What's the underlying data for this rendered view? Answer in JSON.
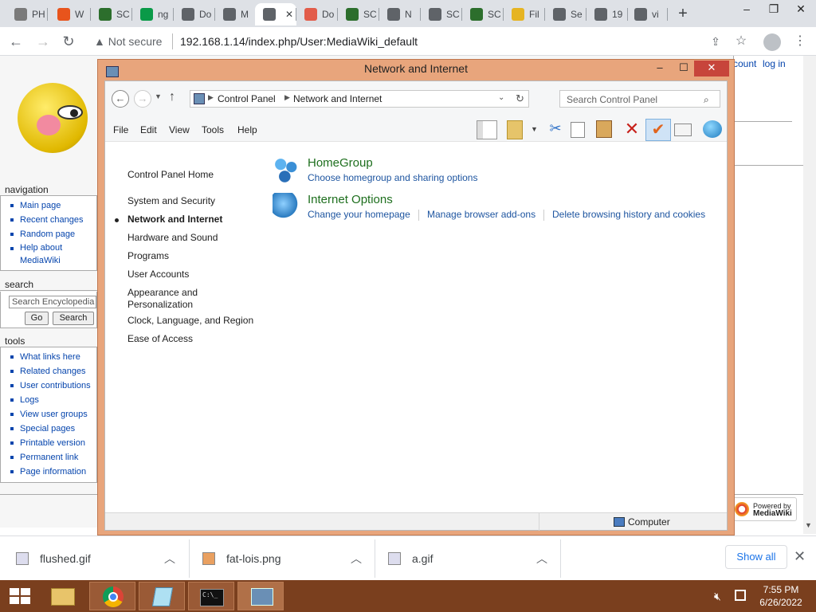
{
  "browser": {
    "tabs": [
      {
        "label": "PH",
        "icon": "globe-icon",
        "color": "#7a7a7a"
      },
      {
        "label": "W",
        "icon": "w-icon",
        "color": "#e8541c"
      },
      {
        "label": "SC",
        "icon": "sql-icon",
        "color": "#2c6e2c"
      },
      {
        "label": "ng",
        "icon": "nginx-icon",
        "color": "#0a9a48"
      },
      {
        "label": "Do",
        "icon": "download-icon",
        "color": "#5f6368"
      },
      {
        "label": "M",
        "icon": "globe-icon",
        "color": "#5f6368"
      },
      {
        "label": "",
        "icon": "globe-icon",
        "color": "#5f6368"
      },
      {
        "label": "Do",
        "icon": "doc-icon",
        "color": "#e25c4a"
      },
      {
        "label": "SC",
        "icon": "sql-icon",
        "color": "#2c6e2c"
      },
      {
        "label": "N",
        "icon": "globe-icon",
        "color": "#5f6368"
      },
      {
        "label": "SC",
        "icon": "diamond-icon",
        "color": "#5f6368"
      },
      {
        "label": "SC",
        "icon": "sql-icon",
        "color": "#2c6e2c"
      },
      {
        "label": "Fil",
        "icon": "folder-icon",
        "color": "#e6b422"
      },
      {
        "label": "Se",
        "icon": "gear-icon",
        "color": "#5f6368"
      },
      {
        "label": "19",
        "icon": "globe-icon",
        "color": "#5f6368"
      },
      {
        "label": "vi",
        "icon": "globe-icon",
        "color": "#5f6368"
      }
    ],
    "new_tab": "+",
    "security_label": "Not secure",
    "url": "192.168.1.14/index.php/User:MediaWiki_default",
    "win_min": "–",
    "win_max": "❐",
    "win_close": "✕"
  },
  "wiki": {
    "personal": [
      "count",
      "log in"
    ],
    "navigation": {
      "title": "navigation",
      "items": [
        "Main page",
        "Recent changes",
        "Random page",
        "Help about MediaWiki"
      ]
    },
    "search": {
      "title": "search",
      "placeholder": "Search Encyclopedia",
      "go": "Go",
      "search": "Search"
    },
    "tools": {
      "title": "tools",
      "items": [
        "What links here",
        "Related changes",
        "User contributions",
        "Logs",
        "View user groups",
        "Special pages",
        "Printable version",
        "Permanent link",
        "Page information"
      ]
    },
    "powered": [
      "Powered by",
      "MediaWiki"
    ]
  },
  "explorer": {
    "title": "Network and Internet",
    "breadcrumb": [
      "Control Panel",
      "Network and Internet"
    ],
    "search_placeholder": "Search Control Panel",
    "menu": [
      "File",
      "Edit",
      "View",
      "Tools",
      "Help"
    ],
    "sidebar": [
      "Control Panel Home",
      "System and Security",
      "Network and Internet",
      "Hardware and Sound",
      "Programs",
      "User Accounts",
      "Appearance and Personalization",
      "Clock, Language, and Region",
      "Ease of Access"
    ],
    "categories": [
      {
        "title": "HomeGroup",
        "links": [
          "Choose homegroup and sharing options"
        ]
      },
      {
        "title": "Internet Options",
        "links": [
          "Change your homepage",
          "Manage browser add-ons",
          "Delete browsing history and cookies"
        ]
      }
    ],
    "status": "Computer"
  },
  "downloads": {
    "items": [
      "flushed.gif",
      "fat-lois.png",
      "a.gif"
    ],
    "show_all": "Show all"
  },
  "taskbar": {
    "time": "7:55 PM",
    "date": "6/26/2022"
  }
}
